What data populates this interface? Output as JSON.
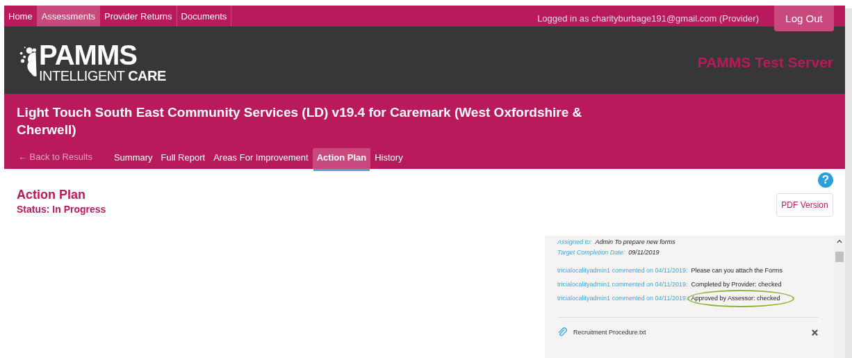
{
  "nav": {
    "items": [
      {
        "label": "Home",
        "selected": false
      },
      {
        "label": "Assessments",
        "selected": true
      },
      {
        "label": "Provider Returns",
        "selected": false
      },
      {
        "label": "Documents",
        "selected": false
      }
    ],
    "user": "Logged in as charityburbage191@gmail.com (Provider)",
    "logout": "Log Out"
  },
  "header": {
    "logo_main": "PAMMS",
    "logo_sub": "INTELLIGENT",
    "logo_sub_bold": "CARE",
    "server": "PAMMS Test Server"
  },
  "title": "Light Touch South East Community Services (LD) v19.4 for Caremark (West Oxfordshire & Cherwell)",
  "back_link": "← Back to Results",
  "tabs": [
    {
      "label": "Summary",
      "selected": false
    },
    {
      "label": "Full Report",
      "selected": false
    },
    {
      "label": "Areas For Improvement",
      "selected": false
    },
    {
      "label": "Action Plan",
      "selected": true
    },
    {
      "label": "History",
      "selected": false
    }
  ],
  "page": {
    "heading": "Action Plan",
    "status": "Status: In Progress",
    "help": "?",
    "pdf": "PDF Version"
  },
  "panel": {
    "fields": [
      {
        "label": "Assigned to:",
        "value": "Admin To prepare new forms"
      },
      {
        "label": "Target Completion Date:",
        "value": "09/11/2019"
      }
    ],
    "comments": [
      {
        "author": "tricialocalityadmin1 commented on 04/11/2019:",
        "text": "Please can you attach the Forms",
        "circled": false
      },
      {
        "author": "tricialocalityadmin1 commented on 04/11/2019:",
        "text": "Completed by Provider: checked",
        "circled": false
      },
      {
        "author": "tricialocalityadmin1 commented on 04/11/2019:",
        "text": "Approved by Assessor: checked",
        "circled": true
      }
    ],
    "attachment": "Recruitment Procedure.txt"
  }
}
